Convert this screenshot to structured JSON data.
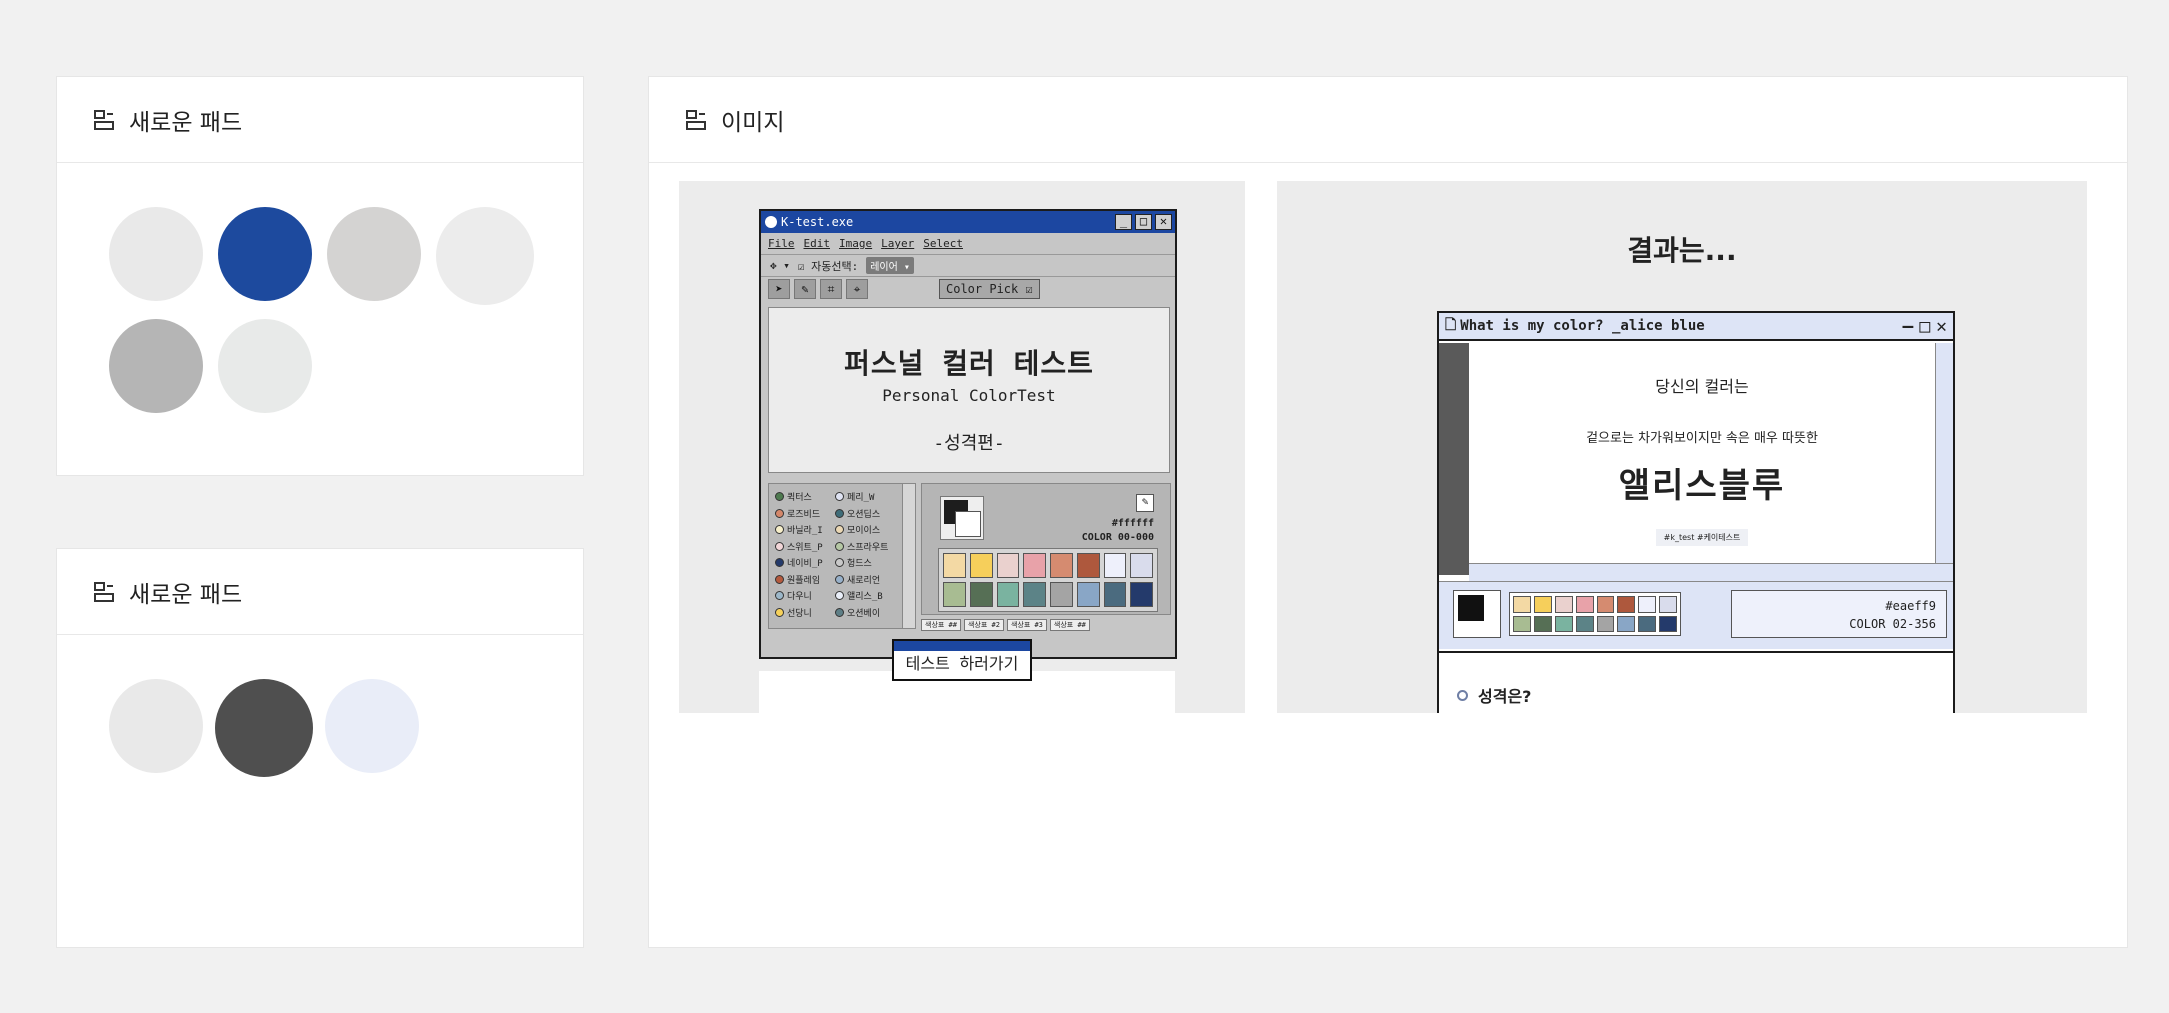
{
  "cards": {
    "pad1": {
      "title": "새로운 패드",
      "icon": "pad-icon",
      "swatches": [
        "#e9e9e9",
        "#1d4a9e",
        "#d4d3d2",
        "#ececec",
        "#b5b5b5",
        "#e8eae9"
      ]
    },
    "pad2": {
      "title": "새로운 패드",
      "icon": "pad-icon",
      "swatches": [
        "#e9e9e9",
        "#4f4f4f",
        "#e9edf8"
      ]
    },
    "image": {
      "title": "이미지",
      "icon": "pad-icon"
    }
  },
  "left_image": {
    "window_title": "K-test.exe",
    "menu": [
      "File",
      "Edit",
      "Image",
      "Layer",
      "Select"
    ],
    "toolbar_text": "☑ 자동선택:",
    "toolbar_chip": "레이어 ▾",
    "color_pick_label": "Color Pick ☑",
    "canvas_title": "퍼스널 컬러 테스트",
    "canvas_subtitle": "Personal ColorTest",
    "canvas_subtitle2": "-성격편-",
    "layers": [
      {
        "name": "퀵터스",
        "color": "#4e7a4f"
      },
      {
        "name": "로즈비드",
        "color": "#d4876a"
      },
      {
        "name": "바닐라_I",
        "color": "#f6eec9"
      },
      {
        "name": "스위트_P",
        "color": "#f2d6d8"
      },
      {
        "name": "네이비_P",
        "color": "#243a6b"
      },
      {
        "name": "원플레임",
        "color": "#b45a3e"
      },
      {
        "name": "다우니",
        "color": "#9cb7c9"
      },
      {
        "name": "선당니",
        "color": "#f6d15b"
      },
      {
        "name": "페리_W",
        "color": "#dfe3f3"
      },
      {
        "name": "오션딥스",
        "color": "#3f6d79"
      },
      {
        "name": "모이이스",
        "color": "#ead7b4"
      },
      {
        "name": "스프라우트",
        "color": "#b5c7a4"
      },
      {
        "name": "헝드스",
        "color": "#c9c9c9"
      },
      {
        "name": "새로리언",
        "color": "#97b0c9"
      },
      {
        "name": "앨리스_B",
        "color": "#eaeff9"
      },
      {
        "name": "오션베이",
        "color": "#5e7f87"
      }
    ],
    "hex": "#ffffff",
    "color_code": "COLOR 00-000",
    "palette": [
      "#f3d9a4",
      "#f6cf5b",
      "#ead1ce",
      "#e8a2a9",
      "#d58b70",
      "#ae583d",
      "#eef0fb",
      "#d9dcec",
      "#a8bc92",
      "#566f55",
      "#7ab3a0",
      "#5c8387",
      "#a4a4a4",
      "#89a6c6",
      "#4b6b7f",
      "#243a6b"
    ],
    "palette_tabs": [
      "색상표 ##",
      "색상표 #2",
      "색상표 #3",
      "색상표 ##"
    ],
    "popup_label": "테스트 하러가기"
  },
  "right_image": {
    "heading": "결과는...",
    "window_title": "What is my color? _alice blue",
    "intro": "당신의 컬러는",
    "desc": "겉으로는 차가워보이지만 속은 매우 따뜻한",
    "result": "앨리스블루",
    "tag": "#k_test #케이테스트",
    "hex": "#eaeff9",
    "color_code": "COLOR 02-356",
    "palette": [
      "#f3d9a4",
      "#f6cf5b",
      "#ead1ce",
      "#e8a2a9",
      "#d58b70",
      "#ae583d",
      "#eef0fb",
      "#d9dcec",
      "#a8bc92",
      "#566f55",
      "#7ab3a0",
      "#5c8387",
      "#a4a4a4",
      "#89a6c6",
      "#4b6b7f",
      "#243a6b"
    ],
    "question": "성격은?"
  }
}
